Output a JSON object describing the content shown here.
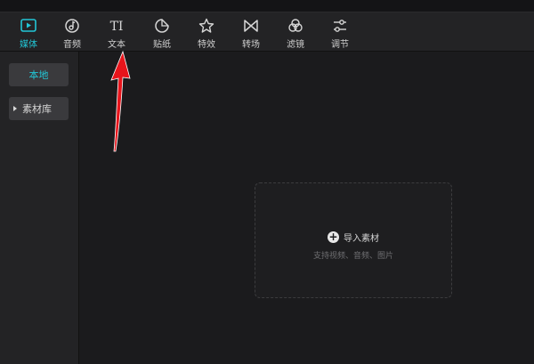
{
  "toolbar": {
    "tools": [
      {
        "label": "媒体",
        "icon": "media-icon",
        "active": true
      },
      {
        "label": "音频",
        "icon": "audio-icon"
      },
      {
        "label": "文本",
        "icon": "text-icon",
        "glyph": "TI"
      },
      {
        "label": "贴纸",
        "icon": "sticker-icon"
      },
      {
        "label": "特效",
        "icon": "effects-icon"
      },
      {
        "label": "转场",
        "icon": "transition-icon"
      },
      {
        "label": "滤镜",
        "icon": "filter-icon"
      },
      {
        "label": "调节",
        "icon": "adjust-icon"
      }
    ]
  },
  "sidebar": {
    "local": "本地",
    "library": "素材库"
  },
  "main": {
    "import_label": "导入素材",
    "import_hint": "支持视频、音频、图片"
  },
  "colors": {
    "accent": "#22c6d6",
    "arrow": "#e8141b"
  }
}
